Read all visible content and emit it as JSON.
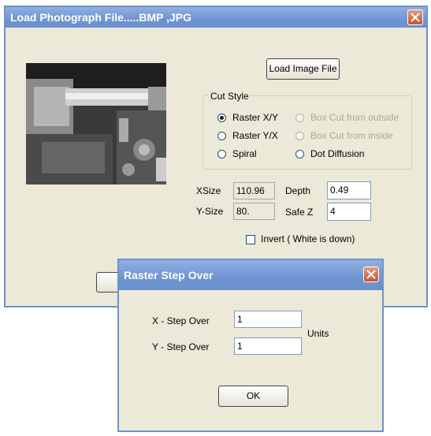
{
  "main_window": {
    "title": "Load Photograph File.....BMP ,JPG",
    "load_button_label": "Load Image File",
    "photo_alt": "lathe photograph",
    "cut_style": {
      "group_label": "Cut Style",
      "options": [
        {
          "label": "Raster X/Y",
          "selected": true,
          "enabled": true
        },
        {
          "label": "Box Cut from outside",
          "selected": false,
          "enabled": false
        },
        {
          "label": "Raster Y/X",
          "selected": false,
          "enabled": true
        },
        {
          "label": "Box Cut from inside",
          "selected": false,
          "enabled": false
        },
        {
          "label": "Spiral",
          "selected": false,
          "enabled": true
        },
        {
          "label": "Dot Diffusion",
          "selected": false,
          "enabled": true
        }
      ]
    },
    "xsize_label": "XSize",
    "xsize_value": "110.96",
    "ysize_label": "Y-Size",
    "ysize_value": "80.",
    "depth_label": "Depth",
    "depth_value": "0.49",
    "safez_label": "Safe Z",
    "safez_value": "4",
    "invert_label": "Invert ( White is down)",
    "invert_checked": false
  },
  "dialog": {
    "title": "Raster Step Over",
    "x_step_label": "X - Step Over",
    "x_step_value": "1",
    "y_step_label": "Y - Step Over",
    "y_step_value": "1",
    "units_label": "Units",
    "ok_label": "OK"
  },
  "colors": {
    "titlebar": "#7098d4",
    "window_bg": "#ece9d8",
    "close_button": "#d0583a"
  }
}
